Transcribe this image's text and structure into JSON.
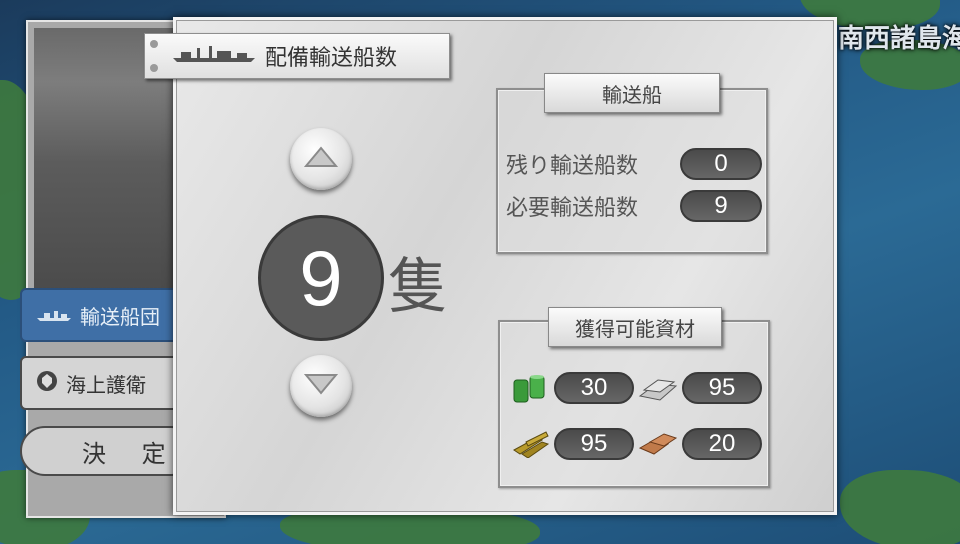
{
  "map": {
    "region_label": "南西諸島海域"
  },
  "left_panel": {
    "transport_button": "輸送船団",
    "escort_button": "海上護衛",
    "decide_button": "決 定"
  },
  "dialog": {
    "title": "配備輸送船数",
    "count": "9",
    "unit": "隻"
  },
  "ships": {
    "title": "輸送船",
    "remaining_label": "残り輸送船数",
    "remaining_value": "0",
    "required_label": "必要輸送船数",
    "required_value": "9"
  },
  "resources": {
    "title": "獲得可能資材",
    "fuel": "30",
    "steel": "95",
    "ammo": "95",
    "bauxite": "20"
  },
  "icons": {
    "up": "arrow-up-icon",
    "down": "arrow-down-icon",
    "ship": "transport-ship-icon",
    "fuel": "fuel-drum-icon",
    "steel": "steel-ingot-icon",
    "ammo": "ammo-shell-icon",
    "bauxite": "bauxite-block-icon"
  },
  "colors": {
    "transport_button": "#3f6fa6",
    "pill": "#555555",
    "count_circle": "#5a5a5a"
  }
}
